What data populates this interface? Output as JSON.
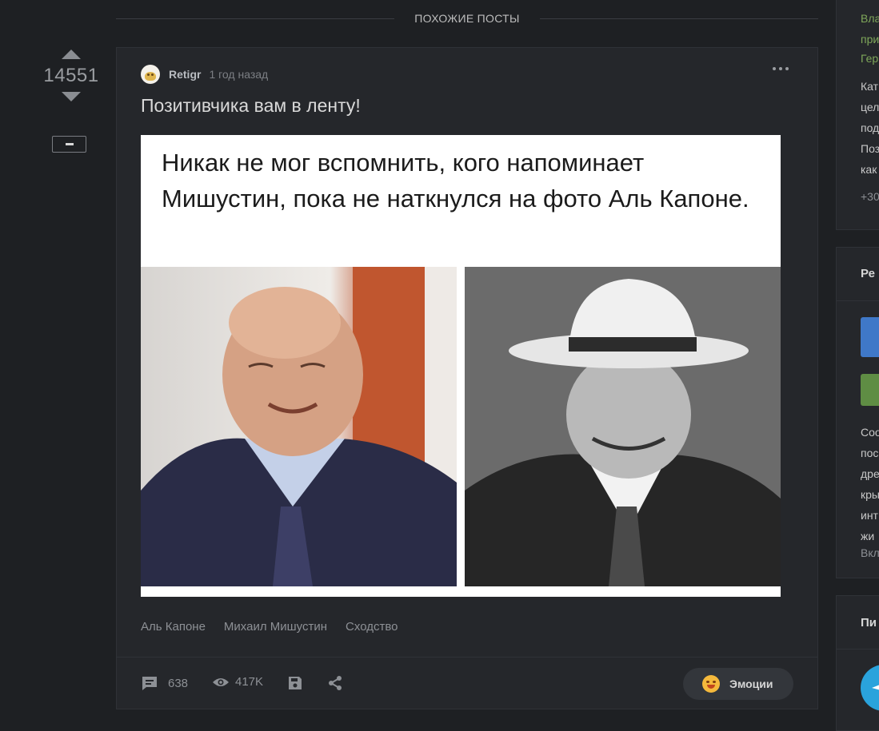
{
  "section": {
    "title": "ПОХОЖИЕ ПОСТЫ"
  },
  "post": {
    "rating": "14551",
    "author": "Retigr",
    "time": "1 год назад",
    "title": "Позитивчика вам в ленту!",
    "image_caption": "Никак не мог вспомнить, кого напоминает Мишустин, пока не наткнулся на фото Аль Капоне.",
    "tags": [
      "Аль Капоне",
      "Михаил Мишустин",
      "Сходство"
    ],
    "stats": {
      "comments": "638",
      "views": "417K"
    },
    "emotions_label": "Эмоции"
  },
  "sidebar": {
    "block1_links": [
      "Вла",
      "при",
      "Гер"
    ],
    "block1_text": [
      "Кат",
      "цел",
      "под",
      "Поз",
      "как"
    ],
    "block1_count": "+30",
    "block2_title": "Ре",
    "block2_text": [
      "Соо",
      "пос",
      "дре",
      "кры",
      "инт",
      "жи"
    ],
    "block2_more": "Вкл",
    "block3_title": "Пи"
  },
  "colors": {
    "background": "#1e2023",
    "card": "#25272b",
    "accent_green": "#6e9a4c",
    "telegram": "#2aa3dc"
  },
  "icons": [
    "arrow-up-icon",
    "arrow-down-icon",
    "more-dots-icon",
    "comment-icon",
    "eye-icon",
    "save-icon",
    "share-icon",
    "emoji-icon",
    "telegram-icon"
  ]
}
